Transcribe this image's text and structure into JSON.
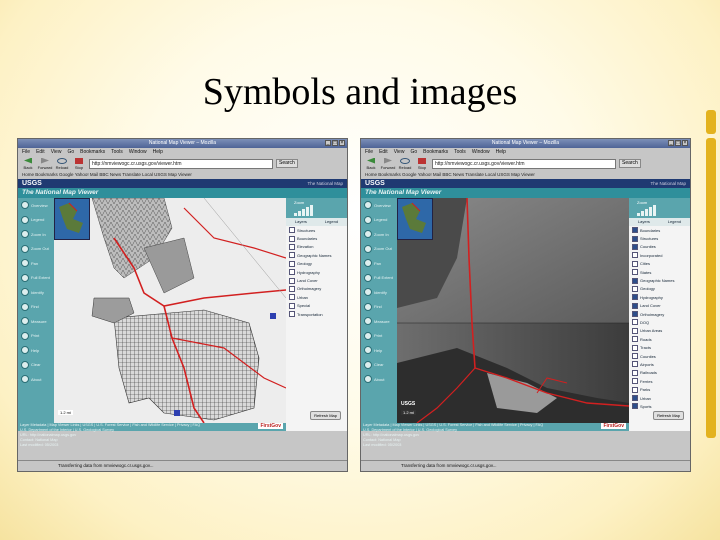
{
  "slide": {
    "title": "Symbols and images"
  },
  "browser": {
    "window_title": "National Map Viewer – Mozilla",
    "menu": [
      "File",
      "Edit",
      "View",
      "Go",
      "Bookmarks",
      "Tools",
      "Window",
      "Help"
    ],
    "nav_buttons": [
      "Back",
      "Forward",
      "Reload",
      "Stop"
    ],
    "url": "http://nmviewogc.cr.usgs.gov/viewer.htm",
    "search_label": "Search",
    "bookmarks": "Home  Bookmarks  Google  Yahoo! Mail  BBC News  Translate  Local  USGS  Map Viewer"
  },
  "viewer": {
    "logo": "USGS",
    "header_link": "The National Map",
    "name": "The National Map Viewer",
    "tools": [
      "Overview",
      "Legend",
      "Zoom In",
      "Zoom Out",
      "Pan",
      "Full Extent",
      "Identify",
      "Find",
      "Measure",
      "Print",
      "Help",
      "Clear",
      "About"
    ],
    "zoom_label": "Zoom",
    "tabs": [
      "Layers",
      "Legend"
    ],
    "credits": [
      "Layer Metadata  |  Map Viewer Links  |  USGS  |  U.S. Forest Service  |  Fish and Wildlife Service  |  Privacy  |  FAQ",
      "U.S. Department of the Interior | U.S. Geological Survey",
      "URL: http://nationalmap.usgs.gov",
      "Contact: National Map",
      "Last modified: 05/2003"
    ],
    "firstgov": "FirstGov",
    "refresh_label": "Refresh Map",
    "status": "Transferring data from nmviewogc.cr.usgs.gov..."
  },
  "left_window": {
    "scale": "1.2 mi",
    "layers": [
      {
        "label": "Structures",
        "on": false
      },
      {
        "label": "Boundaries",
        "on": false
      },
      {
        "label": "Elevation",
        "on": false
      },
      {
        "label": "Geographic Names",
        "on": false
      },
      {
        "label": "Geology",
        "on": false
      },
      {
        "label": "Hydrography",
        "on": false
      },
      {
        "label": "Land Cover",
        "on": false
      },
      {
        "label": "Orthoimagery",
        "on": false
      },
      {
        "label": "Urban",
        "on": false
      },
      {
        "label": "Special",
        "on": false
      },
      {
        "label": "Transportation",
        "on": false
      }
    ]
  },
  "right_window": {
    "scale": "1.2 mi",
    "map_logo": "USGS",
    "layers": [
      {
        "label": "Boundaries",
        "on": true
      },
      {
        "label": "Structures",
        "on": true
      },
      {
        "label": "Counties",
        "on": true
      },
      {
        "label": "Incorporated",
        "on": false
      },
      {
        "label": "Cities",
        "on": false
      },
      {
        "label": "States",
        "on": false
      },
      {
        "label": "Geographic Names",
        "on": true
      },
      {
        "label": "Geology",
        "on": false
      },
      {
        "label": "Hydrography",
        "on": true
      },
      {
        "label": "Land Cover",
        "on": true
      },
      {
        "label": "Orthoimagery",
        "on": true
      },
      {
        "label": "DOQ",
        "on": false
      },
      {
        "label": "Urban Areas",
        "on": false
      },
      {
        "label": "Roads",
        "on": false
      },
      {
        "label": "Tracts",
        "on": false
      },
      {
        "label": "Counties",
        "on": false
      },
      {
        "label": "Airports",
        "on": false
      },
      {
        "label": "Railroads",
        "on": false
      },
      {
        "label": "Ferries",
        "on": false
      },
      {
        "label": "Parks",
        "on": false
      },
      {
        "label": "Urban",
        "on": true
      },
      {
        "label": "Sports",
        "on": true
      },
      {
        "label": "Structures",
        "on": true
      },
      {
        "label": "Transportation",
        "on": true
      }
    ]
  },
  "colors": {
    "page": "#5aa5ad",
    "usgs_bar": "#1f3a72",
    "road": "#d22020",
    "accent_bar": "#e3b21e"
  }
}
